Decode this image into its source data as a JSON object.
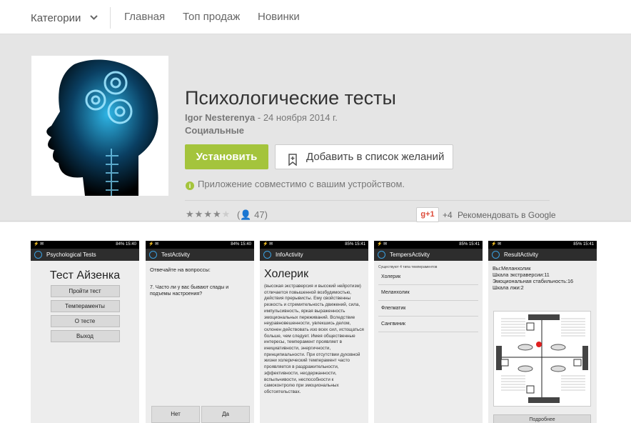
{
  "nav": {
    "categories": "Категории",
    "links": [
      "Главная",
      "Топ продаж",
      "Новинки"
    ]
  },
  "app": {
    "title": "Психологические тесты",
    "developer": "Igor Nesterenya",
    "date_sep": " - ",
    "date": "24 ноября 2014 г.",
    "category": "Социальные",
    "install_label": "Установить",
    "wishlist_label": "Добавить в список желаний",
    "compat_text": "Приложение совместимо с вашим устройством.",
    "rating_stars": 4,
    "rating_count": "47",
    "gplus_label": "+1",
    "gplus_count": "+4",
    "gplus_recommend": "Рекомендовать в Google",
    "accent_color": "#a4c43c"
  },
  "screens": [
    {
      "status_right": "84%  15:40",
      "title": "Psychological Tests",
      "heading": "Тест Айзенка",
      "menu": [
        "Пройти тест",
        "Темпераменты",
        "О тесте",
        "Выход"
      ]
    },
    {
      "status_right": "84%  15:40",
      "title": "TestActivity",
      "prompt": "Отвечайте на вопроссы:",
      "question": "7. Часто ли у вас бывают спады и подъемы настроения?",
      "no": "Нет",
      "yes": "Да"
    },
    {
      "status_right": "85%  15:41",
      "title": "InfoActivity",
      "heading": "Холерик",
      "body": "(высокая экстраверсия и высокий нейротизм) отличается повышенной возбудимостью, действия прерывисты. Ему свойственны резкость и стремительность движений, сила, импульсивность, яркая выраженность эмоциональных переживаний. Вследствие неуравновешенности, увлекшись делом, склонен действовать изо всех сил, истощаться больше, чем следует. Имея общественные интересы, темперамент проявляет в инициативности, энергичности, принципиальности. При отсутствии духовной жизни холерический темперамент часто проявляется в раздражительности, эффективности, несдержанности, вспыльчивости, неспособности к самоконтролю при эмоциональных обстоятельствах."
    },
    {
      "status_right": "85%  15:41",
      "title": "TempersActivity",
      "subtitle": "Существуют 4 типа темпераментов",
      "items": [
        "Холерик",
        "Меланхолик",
        "Флегматик",
        "Сангвиник"
      ]
    },
    {
      "status_right": "85%  15:41",
      "title": "ResultActivity",
      "results": [
        "Вы:Меланхолик",
        "Шкала экстраверсии:11",
        "Эмоциональная стабильность:16",
        "Шкала лжи:2"
      ],
      "more": "Подробнее"
    }
  ]
}
